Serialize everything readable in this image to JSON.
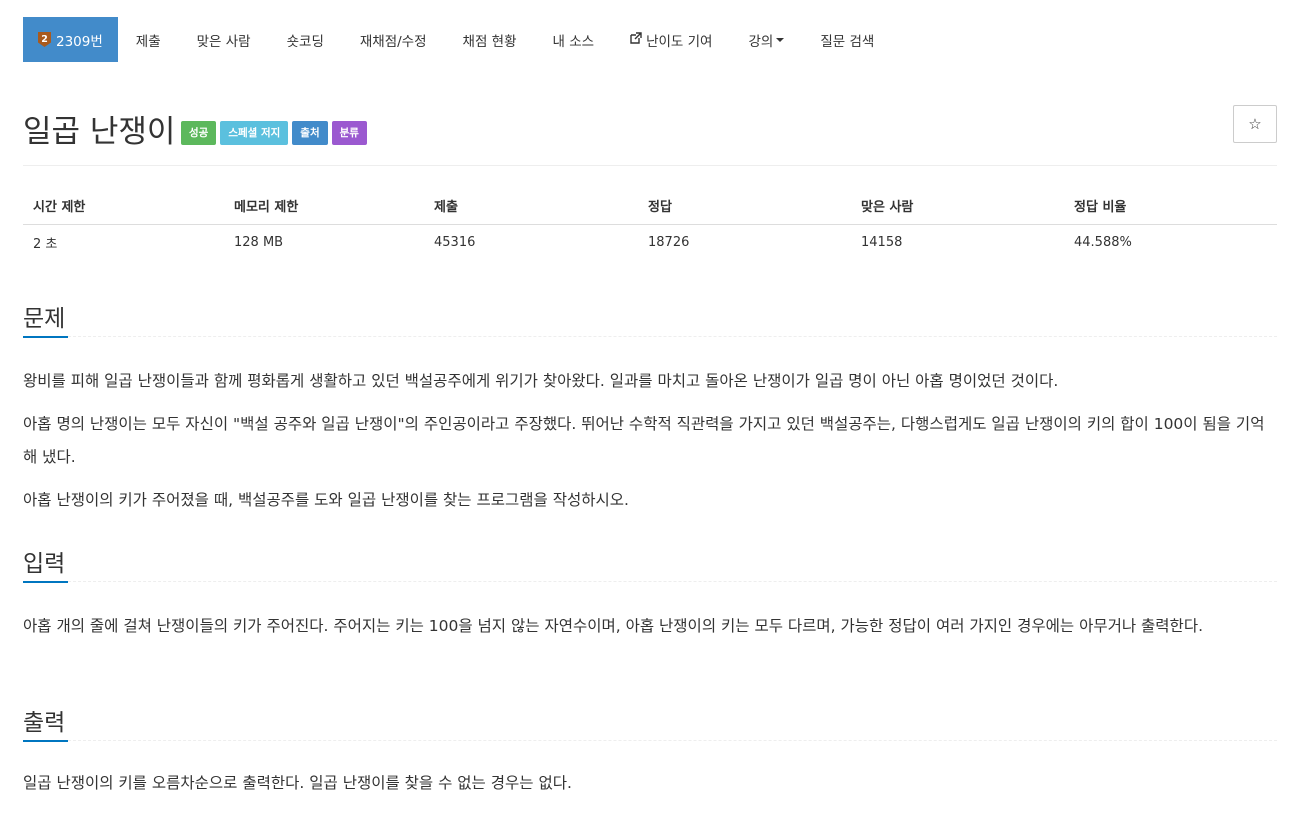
{
  "nav": {
    "problem_badge": "2",
    "problem_number": "2309번",
    "items": [
      "제출",
      "맞은 사람",
      "숏코딩",
      "재채점/수정",
      "채점 현황",
      "내 소스",
      "난이도 기여",
      "강의",
      "질문 검색"
    ]
  },
  "problem": {
    "title": "일곱 난쟁이",
    "labels": [
      {
        "text": "성공",
        "color": "#5cb85c"
      },
      {
        "text": "스페셜 저지",
        "color": "#5bc0de"
      },
      {
        "text": "출처",
        "color": "#428bca"
      },
      {
        "text": "분류",
        "color": "#9b59d0"
      }
    ],
    "star": "☆"
  },
  "stats": {
    "headers": [
      "시간 제한",
      "메모리 제한",
      "제출",
      "정답",
      "맞은 사람",
      "정답 비율"
    ],
    "values": [
      "2 초",
      "128 MB",
      "45316",
      "18726",
      "14158",
      "44.588%"
    ]
  },
  "sections": {
    "description": {
      "heading": "문제",
      "paragraphs": [
        "왕비를 피해 일곱 난쟁이들과 함께 평화롭게 생활하고 있던 백설공주에게 위기가 찾아왔다. 일과를 마치고 돌아온 난쟁이가 일곱 명이 아닌 아홉 명이었던 것이다.",
        "아홉 명의 난쟁이는 모두 자신이 \"백설 공주와 일곱 난쟁이\"의 주인공이라고 주장했다. 뛰어난 수학적 직관력을 가지고 있던 백설공주는, 다행스럽게도 일곱 난쟁이의 키의 합이 100이 됨을 기억해 냈다.",
        "아홉 난쟁이의 키가 주어졌을 때, 백설공주를 도와 일곱 난쟁이를 찾는 프로그램을 작성하시오."
      ]
    },
    "input": {
      "heading": "입력",
      "paragraphs": [
        "아홉 개의 줄에 걸쳐 난쟁이들의 키가 주어진다. 주어지는 키는 100을 넘지 않는 자연수이며, 아홉 난쟁이의 키는 모두 다르며, 가능한 정답이 여러 가지인 경우에는 아무거나 출력한다."
      ]
    },
    "output": {
      "heading": "출력",
      "paragraphs": [
        "일곱 난쟁이의 키를 오름차순으로 출력한다. 일곱 난쟁이를 찾을 수 없는 경우는 없다."
      ]
    }
  },
  "colors": {
    "accent": "#428bca",
    "section_underline": "#0076c0"
  }
}
